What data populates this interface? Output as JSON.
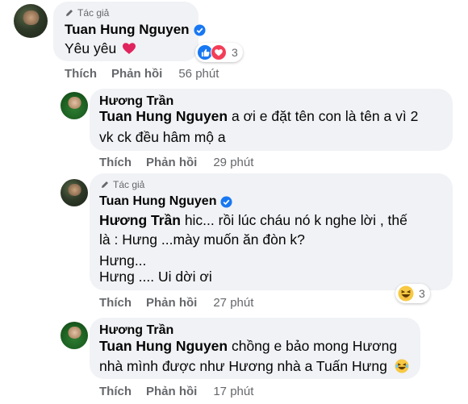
{
  "comments": [
    {
      "author_tag": "Tác giả",
      "name": "Tuan Hung Nguyen",
      "verified": true,
      "text": "Yêu yêu",
      "heart": "❤️",
      "reactions": {
        "count": "3"
      },
      "actions": {
        "like": "Thích",
        "reply": "Phản hồi",
        "time": "56 phút"
      }
    },
    {
      "name": "Hương Trần",
      "mention": "Tuan Hung Nguyen",
      "line1": " a ơi e đặt tên con là tên a vì 2",
      "line2": "vk ck đều hâm mộ a",
      "actions": {
        "like": "Thích",
        "reply": "Phản hồi",
        "time": "29 phút"
      }
    },
    {
      "author_tag": "Tác giả",
      "name": "Tuan Hung Nguyen",
      "verified": true,
      "mention": "Hương Trần",
      "line1": " hic... rồi lúc cháu nó k nghe lời , thế",
      "line2": "là : Hưng ...mày muốn ăn đòn k?",
      "line3": "Hưng...",
      "line4": "Hưng .... Ui dời ơi",
      "reactions": {
        "count": "3"
      },
      "actions": {
        "like": "Thích",
        "reply": "Phản hồi",
        "time": "27 phút"
      }
    },
    {
      "name": "Hương Trần",
      "mention": "Tuan Hung Nguyen",
      "line1": " chồng e bảo mong Hương",
      "line2": "nhà mình được như Hương nhà a Tuấn Hưng",
      "actions": {
        "like": "Thích",
        "reply": "Phản hồi",
        "time": "17 phút"
      }
    }
  ],
  "colors": {
    "bubble": "#f0f2f5",
    "muted": "#65676b",
    "verified": "#1877f2",
    "love": "#f33e58"
  }
}
